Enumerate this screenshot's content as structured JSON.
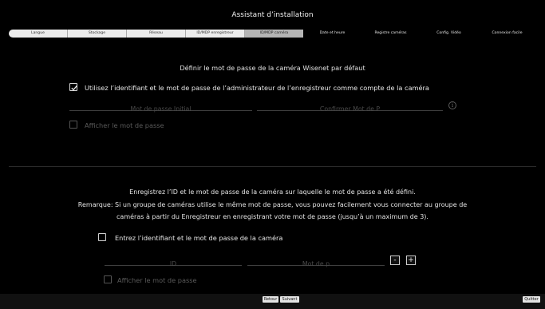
{
  "title": "Assistant d’installation",
  "steps": [
    {
      "label": "Langue"
    },
    {
      "label": "Stockage"
    },
    {
      "label": "Réseau"
    },
    {
      "label": "ID/MDP enregistreur"
    },
    {
      "label": "ID/MDP caméra"
    },
    {
      "label": "Date et heure"
    },
    {
      "label": "Registre caméras"
    },
    {
      "label": "Config. Vidéo"
    },
    {
      "label": "Connexion facile"
    }
  ],
  "section1": {
    "heading": "Définir le mot de passe de la caméra Wisenet par défaut",
    "use_admin_checkbox_label": "Utilisez l’identifiant et le mot de passe de l’administrateur de l’enregistreur comme compte de la caméra",
    "use_admin_checked": true,
    "initial_password_placeholder": "Mot de passe Initial",
    "confirm_password_placeholder": "Confirmer Mot de P",
    "show_password_label": "Afficher le mot de passe",
    "info_glyph": "i"
  },
  "section2": {
    "line1": "Enregistrez l’ID et le mot de passe de la caméra sur laquelle le mot de passe a été défini.",
    "line2": "Remarque: Si un groupe de caméras utilise le même mot de passe, vous pouvez facilement vous connecter au groupe de",
    "line3": "caméras à partir du Enregistreur en enregistrant votre mot de passe (jusqu’à un maximum de 3).",
    "enter_id_checkbox_label": "Entrez l’identifiant et le mot de passe de la caméra",
    "id_placeholder": "ID",
    "password_placeholder": "Mot de p",
    "minus_label": "-",
    "plus_label": "+",
    "show_password_label": "Afficher le mot de passe"
  },
  "buttons": {
    "back": "Retour",
    "next": "Suivant",
    "quit": "Quitter"
  },
  "colors": {
    "background": "#000000",
    "step_done": "#ececec",
    "step_active": "#b5b5b5",
    "text": "#e6e6e6"
  }
}
